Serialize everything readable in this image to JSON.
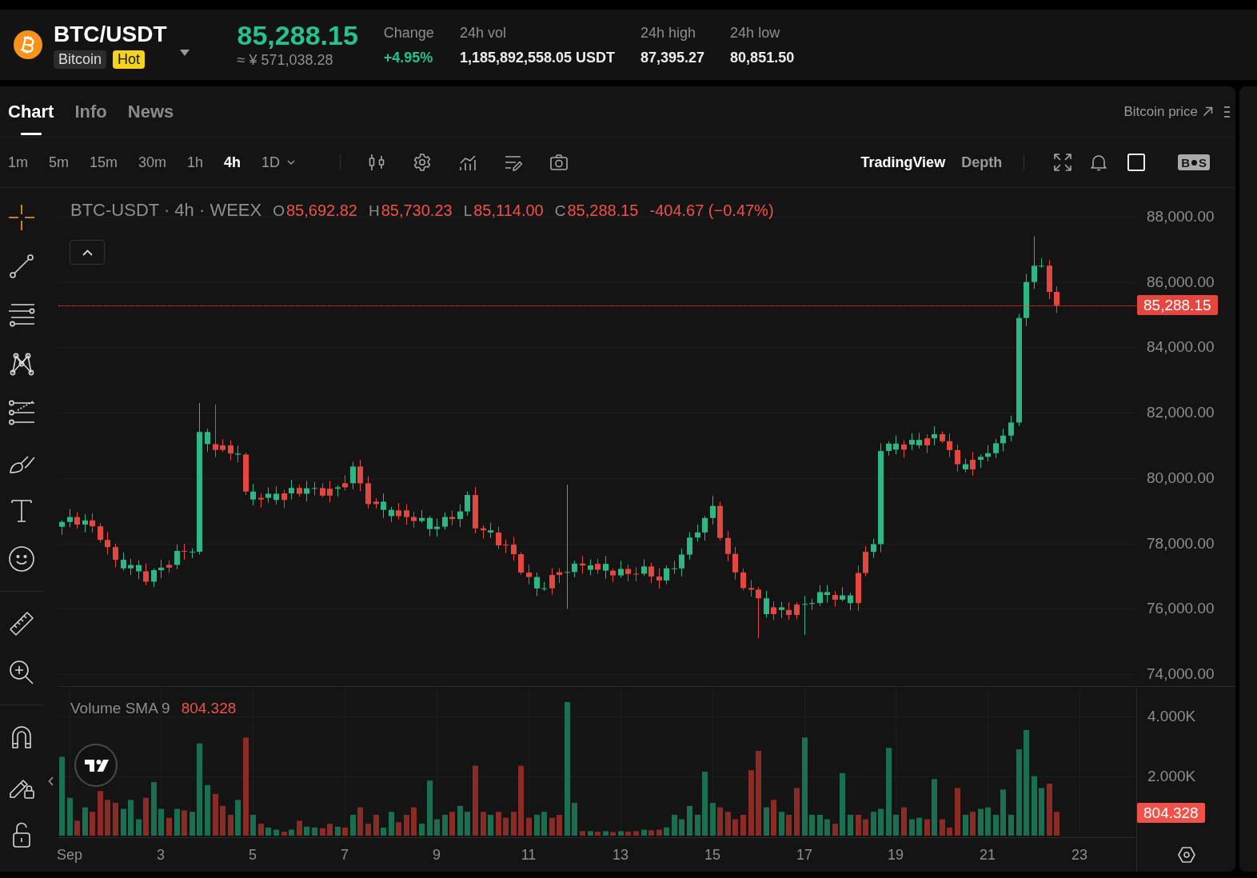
{
  "header": {
    "pair": "BTC/USDT",
    "name_tag": "Bitcoin",
    "hot_tag": "Hot",
    "price": "85,288.15",
    "price_local": "≈ ¥ 571,038.28",
    "stats": [
      {
        "label": "Change",
        "value": "+4.95%",
        "kind": "change"
      },
      {
        "label": "24h vol",
        "value": "1,185,892,558.05 USDT",
        "kind": "plain"
      },
      {
        "label": "24h high",
        "value": "87,395.27",
        "kind": "plain"
      },
      {
        "label": "24h low",
        "value": "80,851.50",
        "kind": "plain"
      }
    ]
  },
  "tabs": [
    {
      "label": "Chart",
      "selected": true
    },
    {
      "label": "Info",
      "selected": false
    },
    {
      "label": "News",
      "selected": false
    }
  ],
  "price_link": "Bitcoin price",
  "intervals": [
    {
      "label": "1m",
      "selected": false,
      "kind": "plain"
    },
    {
      "label": "5m",
      "selected": false,
      "kind": "plain"
    },
    {
      "label": "15m",
      "selected": false,
      "kind": "plain"
    },
    {
      "label": "30m",
      "selected": false,
      "kind": "plain"
    },
    {
      "label": "1h",
      "selected": false,
      "kind": "plain"
    },
    {
      "label": "4h",
      "selected": true,
      "kind": "plain"
    },
    {
      "label": "1D",
      "selected": false,
      "kind": "dropdown"
    }
  ],
  "chart_views": [
    {
      "label": "TradingView",
      "selected": true
    },
    {
      "label": "Depth",
      "selected": false
    }
  ],
  "trade_toggle": [
    "B",
    "S"
  ],
  "drawing_tools": [
    {
      "tools": [
        {
          "kind": "cursor",
          "selected": true
        },
        {
          "kind": "trendline",
          "selected": false
        },
        {
          "kind": "hlines",
          "selected": false
        },
        {
          "kind": "pattern",
          "selected": false
        },
        {
          "kind": "channel",
          "selected": false
        },
        {
          "kind": "brush",
          "selected": false
        },
        {
          "kind": "text",
          "selected": false
        },
        {
          "kind": "emoji",
          "selected": false
        }
      ]
    },
    {
      "tools": [
        {
          "kind": "ruler",
          "selected": false
        },
        {
          "kind": "zoom",
          "selected": false
        }
      ]
    },
    {
      "tools": [
        {
          "kind": "magnet",
          "selected": false
        },
        {
          "kind": "drawlock",
          "selected": false
        },
        {
          "kind": "lock",
          "selected": false
        }
      ]
    }
  ],
  "legend": {
    "title": "BTC-USDT · 4h · WEEX",
    "ohlc": [
      {
        "label": "O",
        "value": "85,692.82"
      },
      {
        "label": "H",
        "value": "85,730.23"
      },
      {
        "label": "L",
        "value": "85,114.00"
      },
      {
        "label": "C",
        "value": "85,288.15"
      }
    ],
    "change": "-404.67 (−0.47%)"
  },
  "price_axis": {
    "ticks": [
      "88,000.00",
      "86,000.00",
      "84,000.00",
      "82,000.00",
      "80,000.00",
      "78,000.00",
      "76,000.00",
      "74,000.00"
    ],
    "last_price": "85,288.15"
  },
  "volume": {
    "title": "Volume SMA 9",
    "value": "804.328",
    "last_value": "804.328",
    "chart_data": {
      "type": "bar",
      "stacked": true,
      "grid": true,
      "x": [
        0.833,
        1,
        1.167,
        1.333,
        1.5,
        1.667,
        1.833,
        2,
        2.167,
        2.333,
        2.5,
        2.667,
        2.833,
        3,
        3.167,
        3.333,
        3.5,
        3.667,
        3.833,
        4,
        4.167,
        4.333,
        4.5,
        4.667,
        4.833,
        5,
        5.167,
        5.333,
        5.5,
        5.667,
        5.833,
        6,
        6.167,
        6.333,
        6.5,
        6.667,
        6.833,
        7,
        7.167,
        7.333,
        7.5,
        7.667,
        7.833,
        8,
        8.167,
        8.333,
        8.5,
        8.667,
        8.833,
        9,
        9.167,
        9.333,
        9.5,
        9.667,
        9.833,
        10,
        10.167,
        10.333,
        10.5,
        10.667,
        10.833,
        11,
        11.167,
        11.333,
        11.5,
        11.667,
        11.833,
        12,
        12.167,
        12.333,
        12.5,
        12.667,
        12.833,
        13,
        13.167,
        13.333,
        13.5,
        13.667,
        13.833,
        14,
        14.167,
        14.333,
        14.5,
        14.667,
        14.833,
        15,
        15.167,
        15.333,
        15.5,
        15.667,
        15.833,
        16,
        16.167,
        16.333,
        16.5,
        16.667,
        16.833,
        17,
        17.167,
        17.333,
        17.5,
        17.667,
        17.833,
        18,
        18.167,
        18.333,
        18.5,
        18.667,
        18.833,
        19,
        19.167,
        19.333,
        19.5,
        19.667,
        19.833,
        20,
        20.167,
        20.333,
        20.5,
        20.667,
        20.833,
        21,
        21.167,
        21.333,
        21.5,
        21.667,
        21.833,
        22,
        22.167,
        22.333,
        22.5
      ],
      "xlim": [
        0.763,
        24.233
      ],
      "ylim": [
        0,
        5000
      ],
      "xticks": [
        {
          "value": 1,
          "label": "Sep"
        },
        {
          "value": 3,
          "label": "3"
        },
        {
          "value": 5,
          "label": "5"
        },
        {
          "value": 7,
          "label": "7"
        },
        {
          "value": 9,
          "label": "9"
        },
        {
          "value": 11,
          "label": "11"
        },
        {
          "value": 13,
          "label": "13"
        },
        {
          "value": 15,
          "label": "15"
        },
        {
          "value": 17,
          "label": "17"
        },
        {
          "value": 19,
          "label": "19"
        },
        {
          "value": 21,
          "label": "21"
        },
        {
          "value": 23,
          "label": "23"
        }
      ],
      "yticks": [
        {
          "value": 2000,
          "label": "2.000K"
        },
        {
          "value": 4000,
          "label": "4.000K"
        }
      ],
      "series": [
        {
          "color": "#1c6e50",
          "values": [
            2650,
            1270,
            null,
            950,
            null,
            null,
            null,
            null,
            900,
            1200,
            550,
            null,
            1800,
            900,
            null,
            900,
            null,
            800,
            3100,
            1700,
            null,
            null,
            null,
            1200,
            null,
            700,
            null,
            270,
            200,
            null,
            200,
            null,
            300,
            270,
            null,
            null,
            300,
            null,
            700,
            null,
            null,
            null,
            270,
            800,
            null,
            null,
            null,
            400,
            1850,
            550,
            700,
            null,
            1000,
            800,
            null,
            null,
            700,
            null,
            null,
            null,
            null,
            null,
            700,
            800,
            null,
            null,
            4490,
            1100,
            null,
            150,
            null,
            150,
            null,
            150,
            null,
            null,
            200,
            null,
            null,
            280,
            700,
            550,
            1000,
            700,
            2150,
            1100,
            null,
            null,
            null,
            null,
            null,
            null,
            950,
            null,
            800,
            null,
            null,
            3300,
            700,
            700,
            550,
            null,
            2100,
            700,
            null,
            null,
            800,
            900,
            2950,
            700,
            null,
            550,
            600,
            null,
            1900,
            null,
            null,
            null,
            700,
            null,
            900,
            950,
            700,
            1550,
            700,
            2900,
            3550,
            2000,
            1600,
            null,
            null
          ]
        },
        {
          "color": "#8a2b26",
          "values": [
            null,
            null,
            500,
            null,
            800,
            1500,
            1200,
            1100,
            null,
            null,
            null,
            1270,
            null,
            null,
            600,
            null,
            850,
            null,
            null,
            null,
            1400,
            1000,
            700,
            null,
            3300,
            null,
            400,
            null,
            null,
            130,
            null,
            500,
            null,
            null,
            250,
            400,
            null,
            270,
            null,
            950,
            400,
            700,
            null,
            null,
            450,
            700,
            950,
            null,
            null,
            null,
            null,
            800,
            null,
            null,
            2350,
            800,
            null,
            800,
            600,
            800,
            2350,
            600,
            null,
            null,
            600,
            700,
            null,
            null,
            150,
            null,
            130,
            null,
            120,
            null,
            130,
            150,
            null,
            180,
            200,
            null,
            null,
            null,
            null,
            null,
            null,
            null,
            950,
            800,
            550,
            700,
            2200,
            2850,
            null,
            1200,
            null,
            700,
            1600,
            null,
            null,
            null,
            null,
            400,
            null,
            null,
            700,
            550,
            null,
            null,
            null,
            null,
            950,
            null,
            null,
            550,
            null,
            550,
            270,
            1600,
            null,
            800,
            null,
            null,
            null,
            null,
            null,
            null,
            null,
            null,
            null,
            1750,
            800
          ]
        }
      ]
    }
  }
}
